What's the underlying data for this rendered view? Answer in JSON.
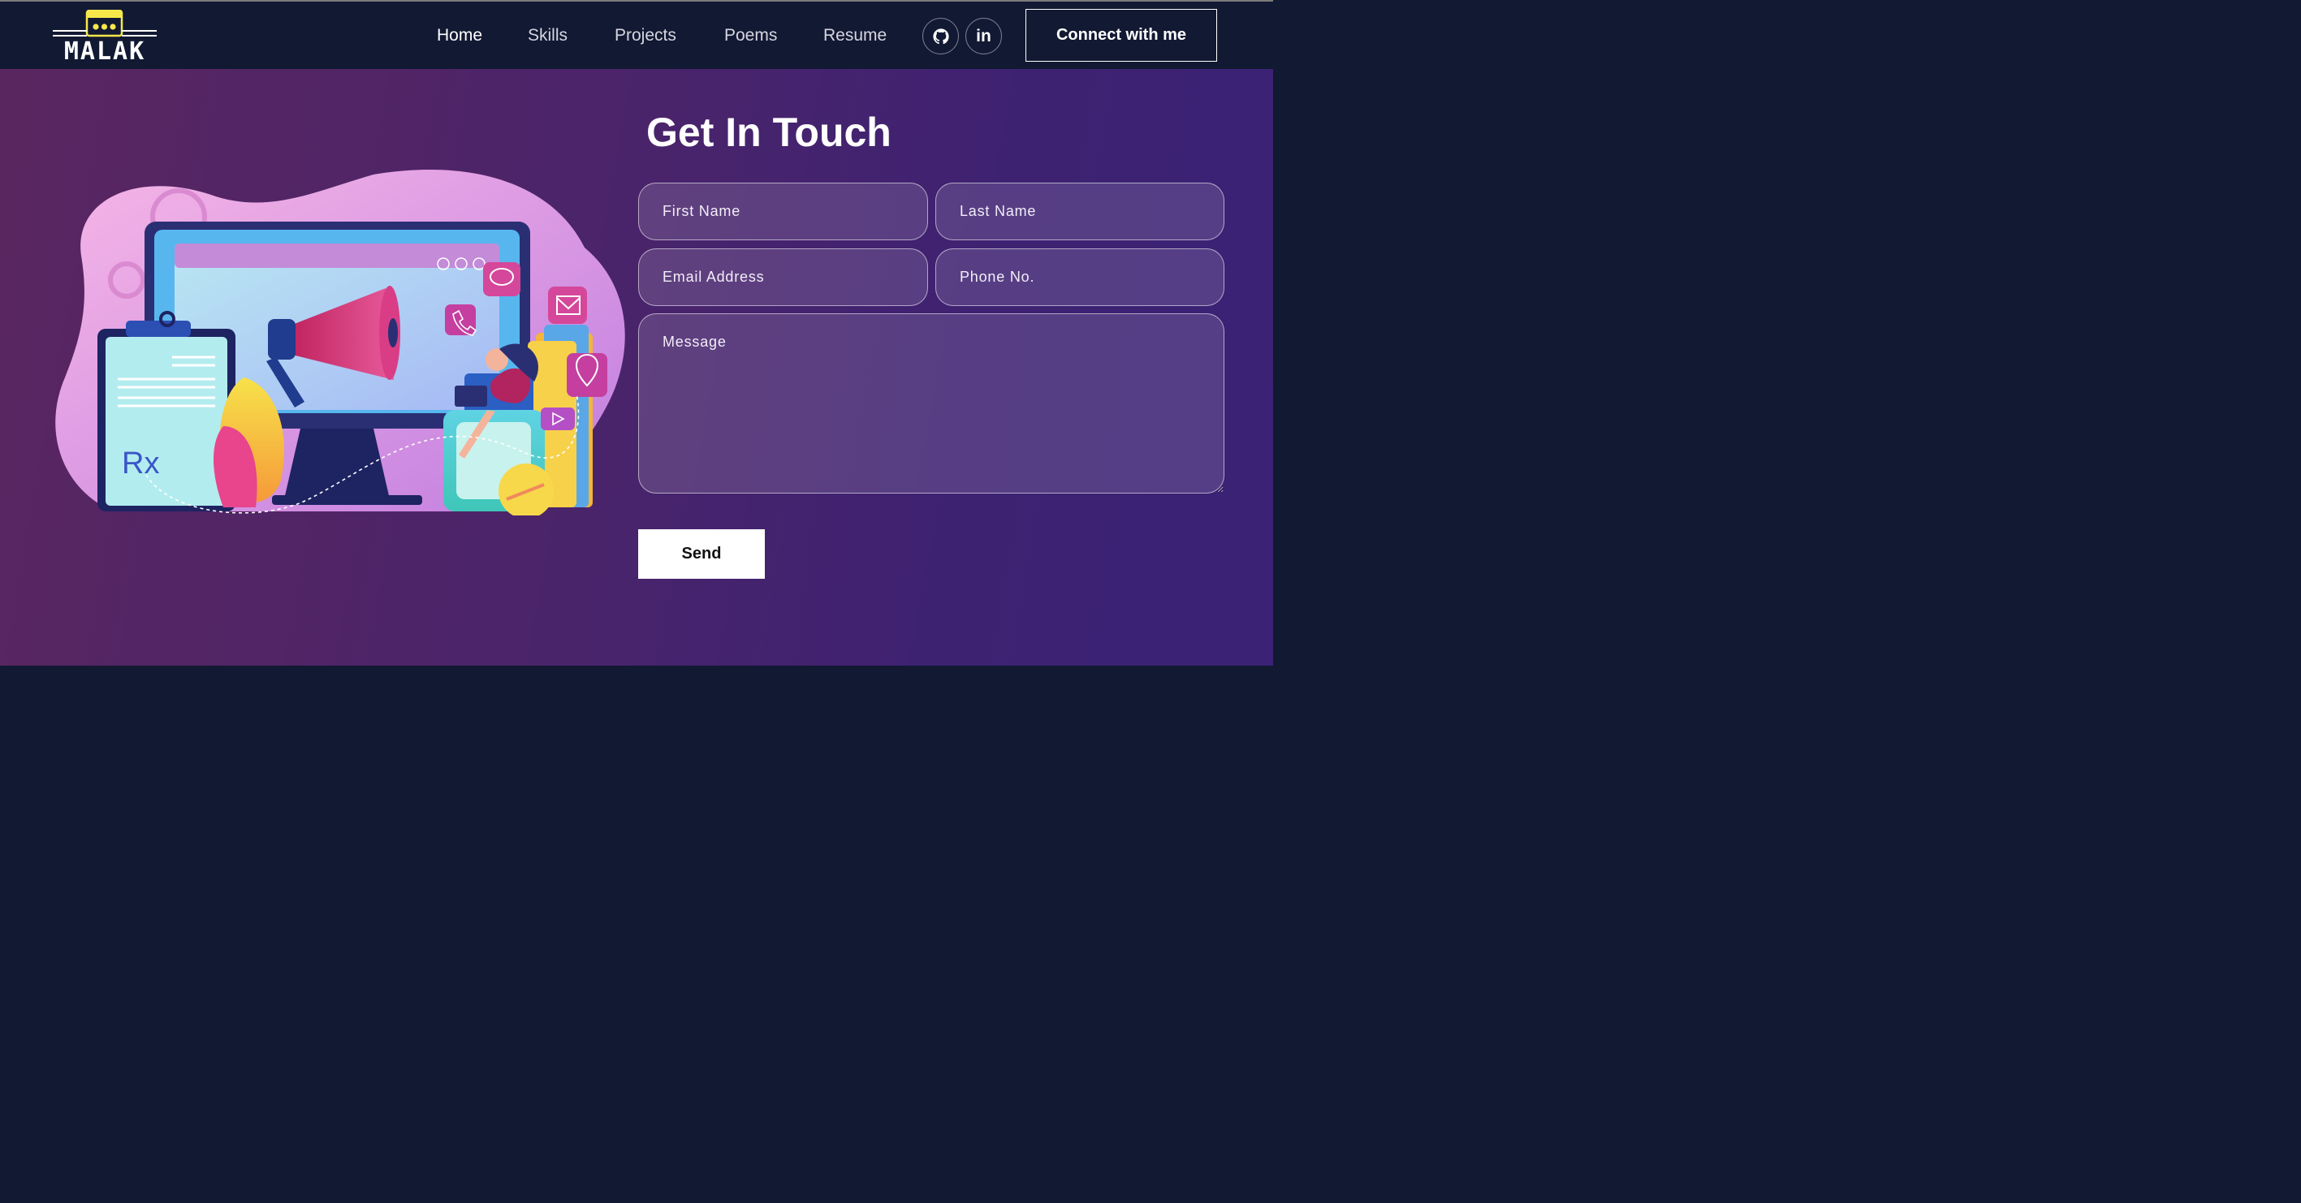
{
  "brand": {
    "logo_text": "MALAK"
  },
  "nav": {
    "links": [
      {
        "label": "Home",
        "active": true
      },
      {
        "label": "Skills"
      },
      {
        "label": "Projects"
      },
      {
        "label": "Poems"
      },
      {
        "label": "Resume"
      }
    ],
    "social": [
      {
        "icon": "github-icon"
      },
      {
        "icon": "linkedin-icon",
        "glyph": "in"
      }
    ],
    "cta_label": "Connect with me"
  },
  "contact": {
    "title": "Get In Touch",
    "fields": {
      "first_name": {
        "placeholder": "First Name"
      },
      "last_name": {
        "placeholder": "Last Name"
      },
      "email": {
        "placeholder": "Email Address"
      },
      "phone": {
        "placeholder": "Phone No."
      },
      "message": {
        "placeholder": "Message"
      }
    },
    "send_label": "Send",
    "illustration": {
      "rx_text": "Rx"
    }
  },
  "colors": {
    "nav_bg": "#121933",
    "hero_gradient_start": "#5a2660",
    "hero_gradient_end": "#3b2275",
    "accent_yellow": "#f6e84a"
  }
}
